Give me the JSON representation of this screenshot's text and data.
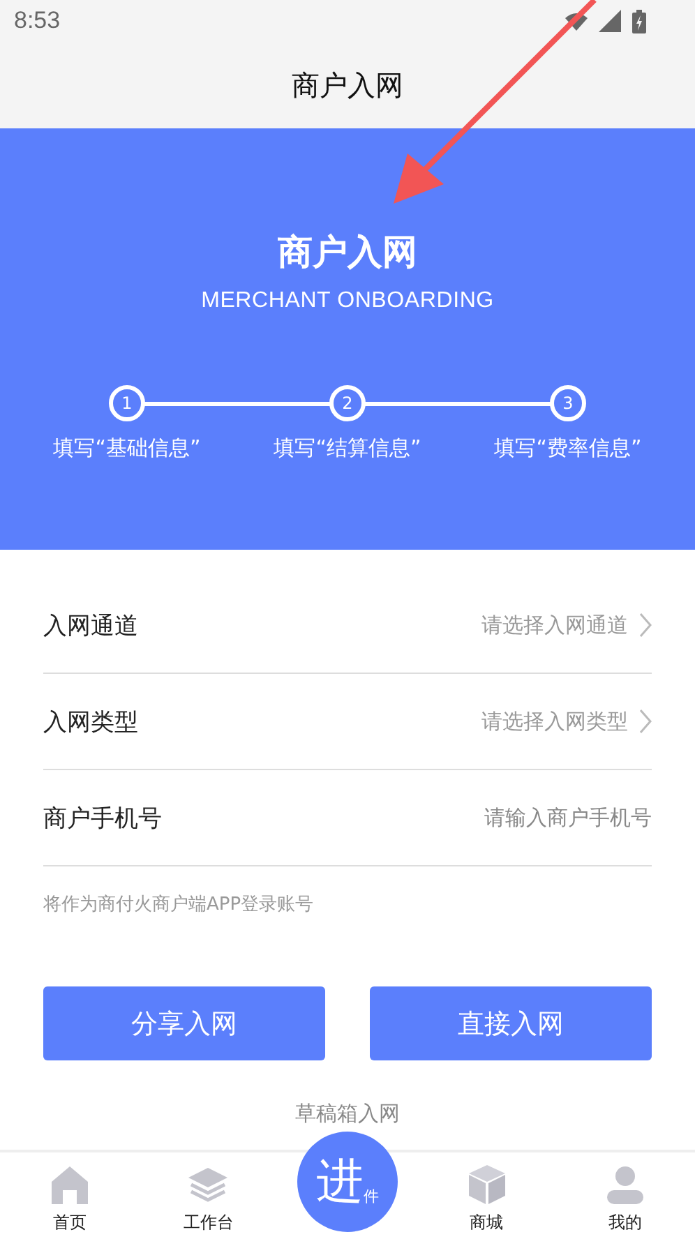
{
  "status_bar": {
    "time": "8:53"
  },
  "nav": {
    "title": "商户入网"
  },
  "banner": {
    "title": "商户入网",
    "subtitle": "MERCHANT ONBOARDING"
  },
  "steps": [
    {
      "number": "1",
      "label": "填写“基础信息”"
    },
    {
      "number": "2",
      "label": "填写“结算信息”"
    },
    {
      "number": "3",
      "label": "填写“费率信息”"
    }
  ],
  "fields": [
    {
      "kind": "select",
      "label": "入网通道",
      "placeholder": "请选择入网通道"
    },
    {
      "kind": "select",
      "label": "入网类型",
      "placeholder": "请选择入网类型"
    },
    {
      "kind": "input",
      "label": "商户手机号",
      "placeholder": "请输入商户手机号"
    }
  ],
  "hint": "将作为商付火商户端APP登录账号",
  "buttons": [
    "分享入网",
    "直接入网"
  ],
  "draft_link": "草稿箱入网",
  "tab_bar": [
    {
      "kind": "home",
      "label": "首页"
    },
    {
      "kind": "layers",
      "label": "工作台"
    },
    {
      "kind": "center",
      "main": "进",
      "sub": "件"
    },
    {
      "kind": "box",
      "label": "商城"
    },
    {
      "kind": "user",
      "label": "我的"
    }
  ]
}
